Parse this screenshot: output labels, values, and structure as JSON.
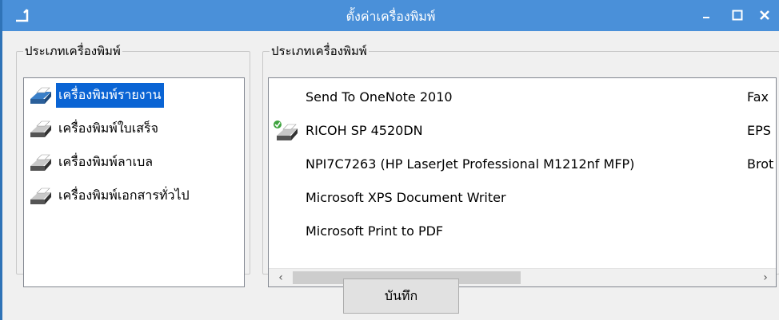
{
  "window": {
    "title": "ตั้งค่าเครื่องพิมพ์",
    "buttons": {
      "minimize": "_",
      "maximize": "☐",
      "close": "✕"
    },
    "colors": {
      "titlebar": "#4a90d9",
      "selection": "#0a64d4"
    }
  },
  "left_group": {
    "legend": "ประเภทเครื่องพิมพ์",
    "items": [
      {
        "label": "เครื่องพิมพ์รายงาน",
        "icon": "printer-icon",
        "selected": true
      },
      {
        "label": "เครื่องพิมพ์ใบเสร็จ",
        "icon": "printer-icon",
        "selected": false
      },
      {
        "label": "เครื่องพิมพ์ลาเบล",
        "icon": "printer-icon",
        "selected": false
      },
      {
        "label": "เครื่องพิมพ์เอกสารทั่วไป",
        "icon": "printer-icon",
        "selected": false
      }
    ]
  },
  "right_group": {
    "legend": "ประเภทเครื่องพิมพ์",
    "printers": [
      {
        "name": "Send To OneNote 2010",
        "driver": "Fax",
        "icon": ""
      },
      {
        "name": "RICOH SP 4520DN",
        "driver": "EPS",
        "icon": "default-printer-icon"
      },
      {
        "name": "NPI7C7263 (HP LaserJet Professional M1212nf MFP)",
        "driver": "Brot",
        "icon": ""
      },
      {
        "name": "Microsoft XPS Document Writer",
        "driver": "",
        "icon": ""
      },
      {
        "name": "Microsoft Print to PDF",
        "driver": "",
        "icon": ""
      }
    ],
    "scrollbar": {
      "left_arrow": "‹",
      "right_arrow": "›"
    }
  },
  "save_button": {
    "label": "บันทึก"
  }
}
